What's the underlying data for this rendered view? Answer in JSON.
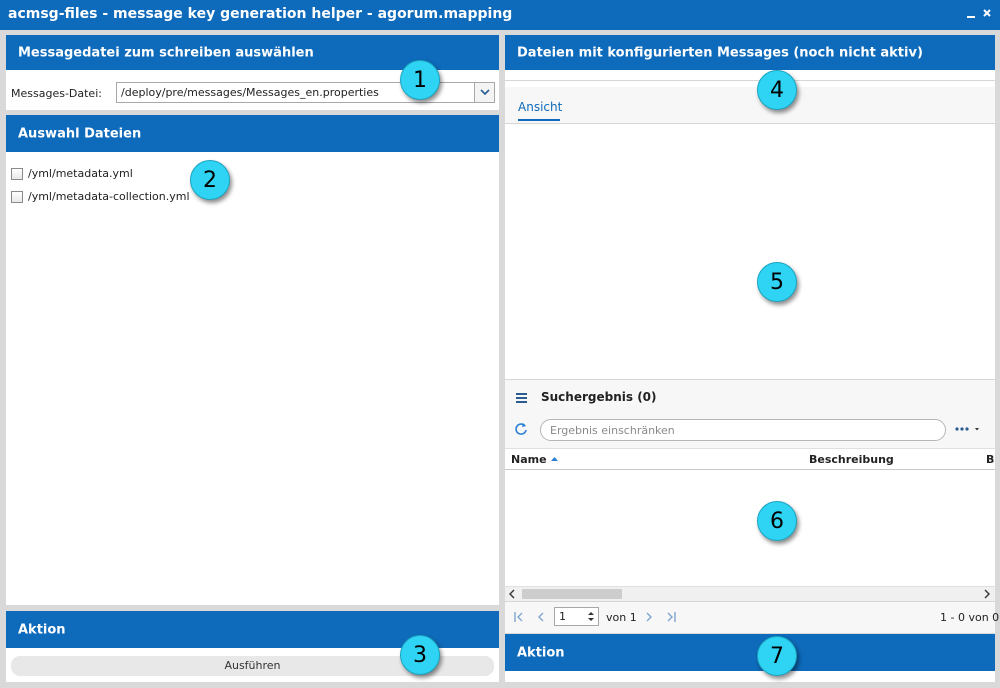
{
  "window": {
    "title": "acmsg-files - message key generation helper - agorum.mapping",
    "minimize_glyph": "‗",
    "close_glyph": "✕"
  },
  "left": {
    "file_panel": {
      "header": "Messagedatei zum schreiben auswählen",
      "field_label": "Messages-Datei:",
      "field_value": "/deploy/pre/messages/Messages_en.properties"
    },
    "files_panel": {
      "header": "Auswahl Dateien",
      "files": [
        "/yml/metadata.yml",
        "/yml/metadata-collection.yml"
      ]
    },
    "action_panel": {
      "header": "Aktion",
      "run_button": "Ausführen"
    }
  },
  "right": {
    "header": "Dateien mit konfigurierten Messages (noch nicht aktiv)",
    "tab_label": "Ansicht",
    "results": {
      "title": "Suchergebnis (0)",
      "filter_placeholder": "Ergebnis einschränken",
      "columns": [
        "Name",
        "Beschreibung",
        "B"
      ],
      "pager": {
        "page_value": "1",
        "of_text": "von 1",
        "summary": "1 - 0 von 0"
      }
    },
    "action_panel": {
      "header": "Aktion"
    }
  },
  "markers": [
    "1",
    "2",
    "3",
    "4",
    "5",
    "6",
    "7"
  ],
  "colors": {
    "brand_blue": "#0e6aba",
    "marker_cyan": "#2fd3f3"
  },
  "icons": {
    "menu": "hamburger-icon",
    "refresh": "refresh-icon",
    "more": "ellipsis-icon",
    "sort": "sort-ascending-icon",
    "dropdown": "chevron-down-icon"
  }
}
